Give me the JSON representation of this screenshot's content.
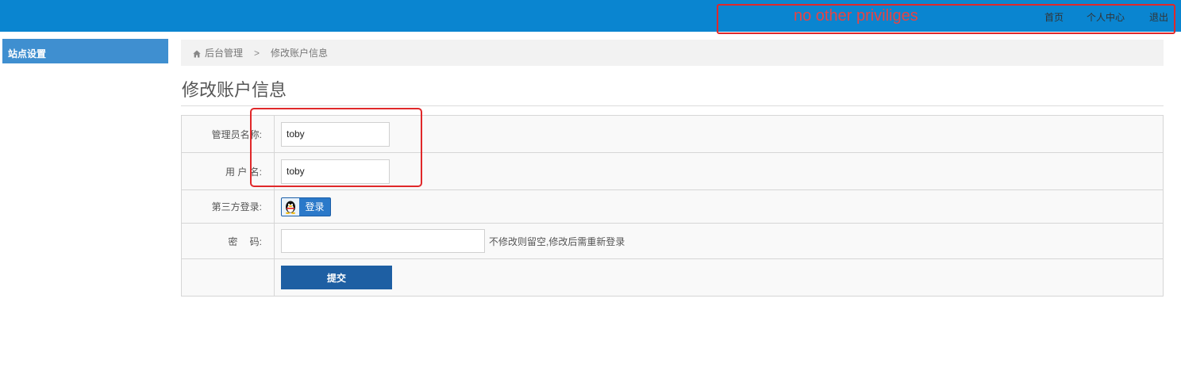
{
  "header": {
    "nav": {
      "home": "首页",
      "personal_center": "个人中心",
      "logout": "退出"
    }
  },
  "annotation": {
    "note": "no other priviliges"
  },
  "sidebar": {
    "items": [
      {
        "label": "站点设置"
      }
    ]
  },
  "breadcrumb": {
    "root": "后台管理",
    "separator": ">",
    "current": "修改账户信息"
  },
  "page": {
    "title": "修改账户信息"
  },
  "form": {
    "admin_name": {
      "label": "管理员名称:",
      "value": "toby"
    },
    "username": {
      "label": "用 户 名:",
      "value": "toby"
    },
    "third_party": {
      "label": "第三方登录:",
      "button": "登录"
    },
    "password": {
      "label": "密　 码:",
      "value": "",
      "hint": "不修改则留空,修改后需重新登录"
    },
    "submit": "提交"
  },
  "colors": {
    "header_bg": "#0a85d0",
    "sidebar_bg": "#3f8fd0",
    "submit_bg": "#1e5fa3",
    "annotation_red": "#e0282a"
  },
  "icons": {
    "breadcrumb_home": "home-icon",
    "qq": "qq-penguin-icon"
  }
}
